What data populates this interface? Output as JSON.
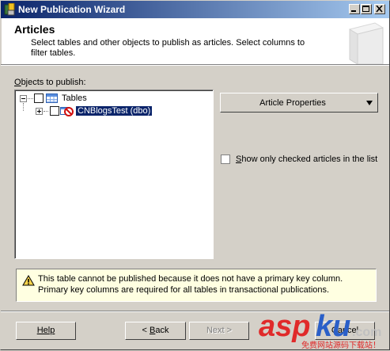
{
  "window": {
    "title": "New Publication Wizard"
  },
  "header": {
    "title": "Articles",
    "description": "Select tables and other objects to publish as articles. Select columns to filter tables."
  },
  "objects": {
    "label_prefix": "O",
    "label_rest": "bjects to publish:",
    "tree": {
      "root": {
        "label": "Tables",
        "checked": false,
        "expanded": true
      },
      "children": [
        {
          "label": "CNBlogsTest (dbo)",
          "checked": false,
          "expanded": false,
          "selected": true
        }
      ]
    }
  },
  "article_properties": {
    "label": "Article Properties"
  },
  "show_only": {
    "label_prefix": "S",
    "label_rest": "how only checked articles in the list",
    "checked": false
  },
  "warning": {
    "icon": "warning-icon",
    "message": "This table cannot be published because it does not have a primary key column. Primary key columns are required for all tables in transactional publications."
  },
  "buttons": {
    "help": "Help",
    "back_prefix": "< ",
    "back_accel": "B",
    "back_rest": "ack",
    "next": "Next >",
    "cancel": "Cancel"
  },
  "watermark": {
    "brand_a": "asp",
    "brand_b": "ku",
    "brand_c": ".com",
    "tagline": "免费网站源码下载站！"
  }
}
